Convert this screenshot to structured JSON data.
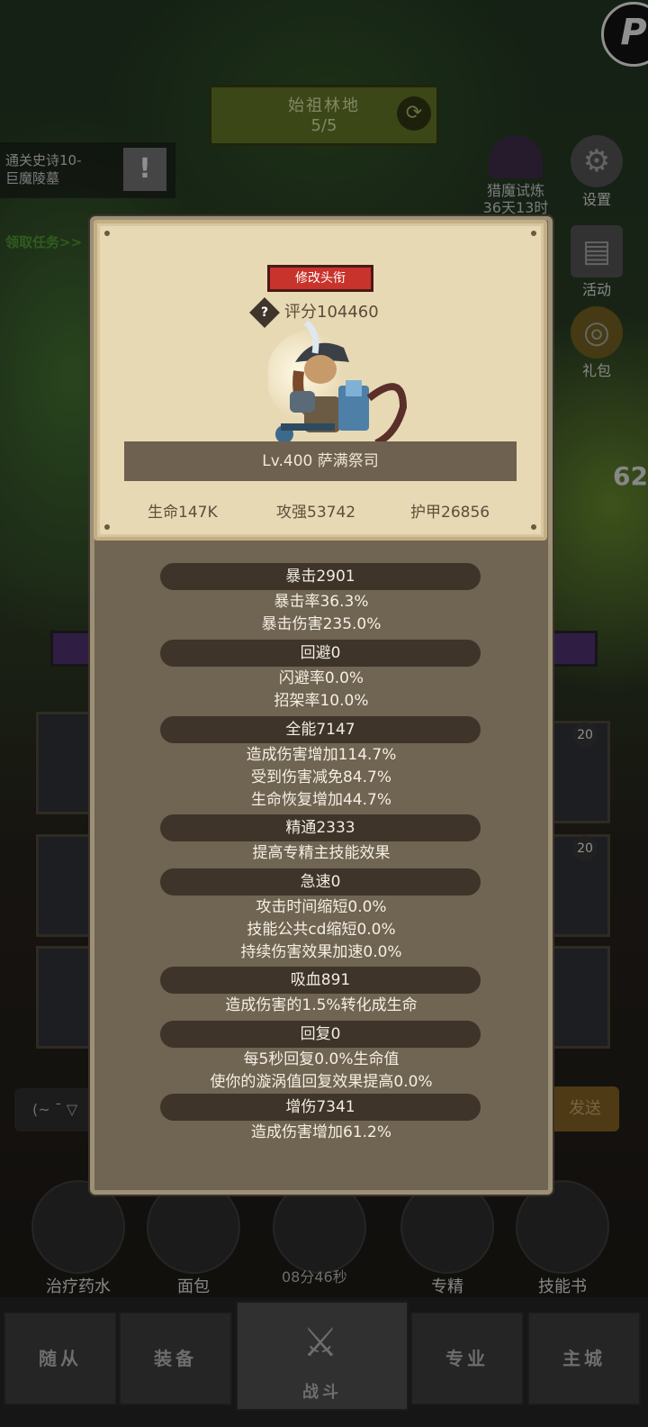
{
  "background": {
    "zone": {
      "name": "始祖林地",
      "progress": "5/5"
    },
    "quest": {
      "line1": "通关史诗10-",
      "line2": "巨魔陵墓",
      "claim": "领取任务>>"
    },
    "hunt": {
      "label": "猎魔试炼",
      "time": "36天13时"
    },
    "side_buttons": [
      {
        "label": "设置",
        "icon": "gear-icon"
      },
      {
        "label": "活动",
        "icon": "scroll-icon"
      },
      {
        "label": "礼包",
        "icon": "gift-icon"
      }
    ],
    "right_number": "62",
    "slot_badges": [
      "20",
      "20"
    ],
    "chat_placeholder": "(~ ¯ ▽",
    "send_label": "发送",
    "items": [
      {
        "label": "治疗药水",
        "icon": "potion-icon"
      },
      {
        "label": "面包",
        "icon": "bread-icon"
      },
      {
        "label": "",
        "icon": "chest-icon"
      },
      {
        "label": "专精",
        "icon": "specialization-icon"
      },
      {
        "label": "技能书",
        "icon": "skillbook-icon"
      }
    ],
    "timer": "08分46秒",
    "nav": [
      {
        "label": "随从"
      },
      {
        "label": "装备"
      },
      {
        "label": "战斗"
      },
      {
        "label": "专业"
      },
      {
        "label": "主城"
      }
    ]
  },
  "profile": {
    "edit_title": "修改头衔",
    "score": "评分104460",
    "name": "Lv.400 萨满祭司",
    "stats": {
      "hp": "生命147K",
      "atk": "攻强53742",
      "armor": "护甲26856"
    }
  },
  "details": [
    {
      "header": "暴击2901",
      "lines": [
        "暴击率36.3%",
        "暴击伤害235.0%"
      ]
    },
    {
      "header": "回避0",
      "lines": [
        "闪避率0.0%",
        "招架率10.0%"
      ]
    },
    {
      "header": "全能7147",
      "lines": [
        "造成伤害增加114.7%",
        "受到伤害减免84.7%",
        "生命恢复增加44.7%"
      ]
    },
    {
      "header": "精通2333",
      "lines": [
        "提高专精主技能效果"
      ]
    },
    {
      "header": "急速0",
      "lines": [
        "攻击时间缩短0.0%",
        "技能公共cd缩短0.0%",
        "持续伤害效果加速0.0%"
      ]
    },
    {
      "header": "吸血891",
      "lines": [
        "造成伤害的1.5%转化成生命"
      ]
    },
    {
      "header": "回复0",
      "lines": [
        "每5秒回复0.0%生命值",
        "使你的漩涡值回复效果提高0.0%"
      ]
    },
    {
      "header": "增伤7341",
      "lines": [
        "造成伤害增加61.2%"
      ]
    }
  ]
}
